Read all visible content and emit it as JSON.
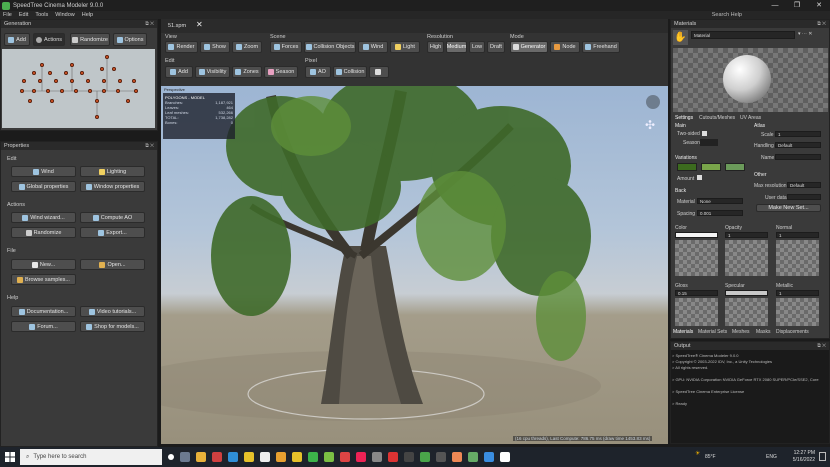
{
  "window": {
    "title": "SpeedTree Cinema Modeler 9.0.0",
    "min": "—",
    "max": "❐",
    "close": "✕"
  },
  "menu": {
    "items": [
      "File",
      "Edit",
      "Tools",
      "Window",
      "Help"
    ],
    "search_help": "Search Help"
  },
  "generation": {
    "title": "Generation",
    "buttons": [
      "Add",
      "Actions",
      "Randomize",
      "Options"
    ]
  },
  "document_tab": {
    "name": "51.spm",
    "close": "✕"
  },
  "toolbar": {
    "view_label": "View",
    "view_buttons": [
      "Render",
      "Show",
      "Zoom"
    ],
    "scene_label": "Scene",
    "scene_buttons": [
      "Forces",
      "Collision Objects",
      "Wind",
      "Light"
    ],
    "resolution_label": "Resolution",
    "resolution_buttons": [
      "High",
      "Medium",
      "Low",
      "Draft"
    ],
    "resolution_selected": "Medium",
    "mode_label": "Mode",
    "mode_buttons": [
      "Generator",
      "Node",
      "Freehand"
    ],
    "edit_label": "Edit",
    "edit_buttons": [
      "Add",
      "Visibility",
      "Zones",
      "Season"
    ],
    "pixel_label": "Pixel",
    "pixel_buttons": [
      "AO",
      "Collision",
      ""
    ]
  },
  "viewport": {
    "label": "Perspective",
    "stats_title": "POLYGONS - MODEL",
    "stats": [
      {
        "k": "Branches:",
        "v": "1,187,921"
      },
      {
        "k": "Leaves:",
        "v": "464"
      },
      {
        "k": "Leaf meshes:",
        "v": "532,266"
      },
      {
        "k": "TOTAL:",
        "v": "1,738,282"
      },
      {
        "k": "Bones:",
        "v": "0"
      }
    ],
    "status": "(16 cpu threads), Last Compute: 786.75 ms (draw time 1453.83 ms)"
  },
  "properties": {
    "title": "Properties",
    "edit_label": "Edit",
    "edit_buttons": [
      "Wind",
      "Lighting",
      "Global properties",
      "Window properties"
    ],
    "actions_label": "Actions",
    "actions_buttons": [
      "Wind wizard...",
      "Compute AO",
      "Randomize",
      "Export..."
    ],
    "file_label": "File",
    "file_buttons": [
      "New...",
      "Open...",
      "Browse samples..."
    ],
    "help_label": "Help",
    "help_buttons": [
      "Documentation...",
      "Video tutorials...",
      "Forum...",
      "Shop for models..."
    ]
  },
  "materials": {
    "title": "Materials",
    "dropdown": "Material",
    "tabs": [
      "Settings",
      "Cutouts/Meshes",
      "UV Areas"
    ],
    "main_label": "Main",
    "two_sided": "Two-sided",
    "season_label": "Season",
    "atlas_label": "Atlas",
    "scale_label": "Scale",
    "scale_value": "1",
    "handling_label": "Handling",
    "handling_value": "Default",
    "name_label": "Name",
    "variations_label": "Variations",
    "amount_label": "Amount",
    "other_label": "Other",
    "max_res_label": "Max resolution",
    "max_res_value": "Default",
    "user_data_label": "User data",
    "make_new_set": "Make New Set...",
    "back_label": "Back",
    "back_material_label": "Material",
    "back_material_value": "None",
    "spacing_label": "Spacing",
    "spacing_value": "0.001",
    "maps": [
      {
        "name": "Color",
        "value": ""
      },
      {
        "name": "Opacity",
        "value": "1"
      },
      {
        "name": "Normal",
        "value": "1"
      },
      {
        "name": "Gloss",
        "value": "0.15"
      },
      {
        "name": "Specular",
        "value": ""
      },
      {
        "name": "Metallic",
        "value": "1"
      }
    ],
    "bottom_tabs": [
      "Materials",
      "Material Sets",
      "Meshes",
      "Masks",
      "Displacements"
    ]
  },
  "output": {
    "title": "Output",
    "lines": [
      "> SpeedTree® Cinema Modeler 9.0.0",
      "> Copyright © 2003-2022 IDV, Inc., a Unity Technologies",
      "> All rights reserved.",
      "",
      "> GPU: NVIDIA Corporation NVIDIA GeForce RTX 2080 SUPER/PCIe/SSE2, Core",
      "",
      "> SpeedTree Cinema Enterprise License",
      "",
      "> Ready"
    ]
  },
  "taskbar": {
    "search_placeholder": "Type here to search",
    "weather": "85°F",
    "lang": "ENG",
    "time": "12:27 PM",
    "date": "5/16/2022"
  },
  "colors": {
    "accent": "#4a90d9",
    "panel": "#3a3a3a",
    "sky": "#9db5d3"
  }
}
